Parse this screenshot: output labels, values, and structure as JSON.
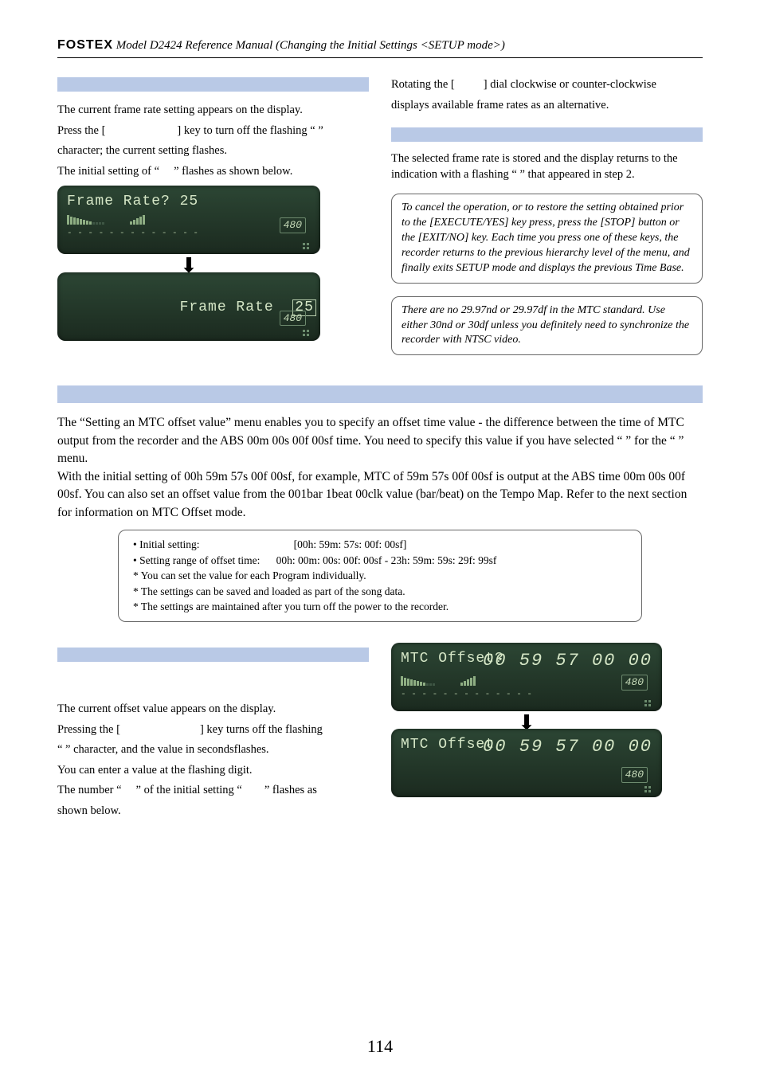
{
  "header": {
    "brand": "FOSTEX",
    "title": "Model D2424  Reference Manual (Changing the Initial Settings <SETUP mode>)"
  },
  "left_top": {
    "p1": "The current frame rate setting appears on the display.",
    "p2a": "Press the [",
    "p2b": "] key to turn off the flashing “  ”",
    "p3": "character; the current setting flashes.",
    "p4a": "The initial setting of “",
    "p4b": "” flashes as shown below.",
    "lcd1_line": "Frame Rate? 25",
    "lcd1_480": "480",
    "lcd2_labelA": "Frame Rate",
    "lcd2_boxed": "25",
    "lcd2_480": "480"
  },
  "right_top": {
    "r1a": "Rotating the [",
    "r1b": "] dial clockwise or counter-clockwise",
    "r2": "displays available frame rates as an alternative.",
    "r3": "The selected frame rate is stored and the display returns to the indication with a flashing “  ” that appeared in step 2.",
    "box1": "To cancel the operation, or to restore the setting obtained prior to the [EXECUTE/YES] key press, press the [STOP] button or the [EXIT/NO] key.  Each time you press one of these keys, the recorder returns to the previous hierarchy level of the menu, and finally exits SETUP mode and displays the previous Time Base.",
    "box2": "There are no 29.97nd or 29.97df in the MTC standard.  Use either 30nd or 30df unless you definitely need to synchronize the recorder with NTSC video."
  },
  "mid": {
    "p1": "The “Setting an MTC offset value” menu enables you to specify an offset time value - the difference between the time of MTC output from the recorder and the ABS 00m 00s 00f 00sf time.  You need to specify this value if you have selected “        ” for the “                                                ” menu.",
    "p2": "With the initial setting of 00h 59m 57s 00f 00sf, for example, MTC of 59m 57s 00f 00sf is output at the ABS time 00m 00s 00f 00sf.  You can also set an offset value from the 001bar 1beat  00clk value (bar/beat) on the Tempo Map.  Refer to the next section for information on MTC Offset mode."
  },
  "centerbox": {
    "l1a": "• Initial setting:",
    "l1b": "[00h: 59m: 57s: 00f: 00sf]",
    "l2a": "• Setting range of offset time:",
    "l2b": "00h: 00m: 00s: 00f: 00sf - 23h: 59m: 59s: 29f: 99sf",
    "l3": "* You can set the value for each Program individually.",
    "l4": "* The settings can be saved and loaded as part of the song data.",
    "l5": "* The settings are maintained after you turn off the power to the recorder."
  },
  "bottom_left": {
    "p1": "The current offset value appears on the display.",
    "p2a": "Pressing the [",
    "p2b": "] key turns off the flashing",
    "p3": "“  ” character, and the value in secondsflashes.",
    "p4": "You can enter a value at the flashing digit.",
    "p5a": "The number “",
    "p5b": "” of the initial setting “",
    "p5c": "” flashes as",
    "p6": "shown below."
  },
  "bottom_right": {
    "lcd1_label": "MTC Offset?",
    "lcd1_time": "00 59 57 00 00",
    "lcd1_480": "480",
    "lcd2_label": "MTC Offset",
    "lcd2_time_a": "00 59",
    "lcd2_time_box": "57",
    "lcd2_time_b": "00 00",
    "lcd2_480": "480"
  },
  "pagenum": "114"
}
